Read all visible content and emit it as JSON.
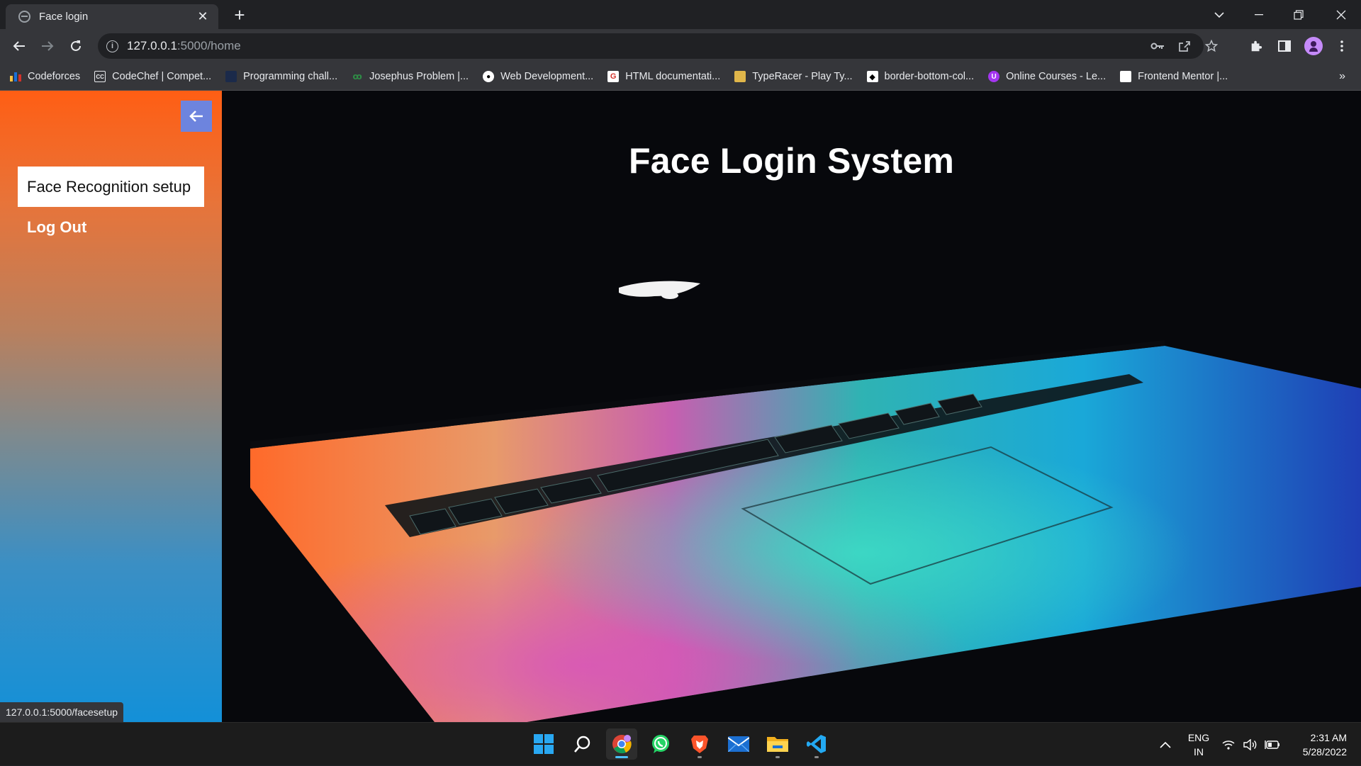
{
  "browser": {
    "tab_title": "Face login",
    "url_host": "127.0.0.1",
    "url_path": ":5000/home",
    "status_url": "127.0.0.1:5000/facesetup"
  },
  "bookmarks": [
    {
      "label": "Codeforces",
      "icon": "codeforces-icon"
    },
    {
      "label": "CodeChef | Compet...",
      "icon": "codechef-icon"
    },
    {
      "label": "Programming chall...",
      "icon": "programming-icon"
    },
    {
      "label": "Josephus Problem |...",
      "icon": "geeksforgeeks-icon"
    },
    {
      "label": "Web Development...",
      "icon": "webdev-icon"
    },
    {
      "label": "HTML documentati...",
      "icon": "html-doc-icon"
    },
    {
      "label": "TypeRacer - Play Ty...",
      "icon": "typeracer-icon"
    },
    {
      "label": "border-bottom-col...",
      "icon": "codepen-icon"
    },
    {
      "label": "Online Courses - Le...",
      "icon": "udemy-icon"
    },
    {
      "label": "Frontend Mentor |...",
      "icon": "frontend-mentor-icon"
    }
  ],
  "sidebar": {
    "back_icon": "arrow-left-icon",
    "items": [
      {
        "label": "Face Recognition setup",
        "active": true
      },
      {
        "label": "Log Out",
        "active": false
      }
    ]
  },
  "main": {
    "title": "Face Login System"
  },
  "taskbar": {
    "lang_top": "ENG",
    "lang_bottom": "IN",
    "time": "2:31 AM",
    "date": "5/28/2022"
  },
  "colors": {
    "sidebar_top": "#ff5e14",
    "sidebar_bottom": "#1390d8",
    "back_button": "#6d84de",
    "hero_bg": "#07080c"
  }
}
